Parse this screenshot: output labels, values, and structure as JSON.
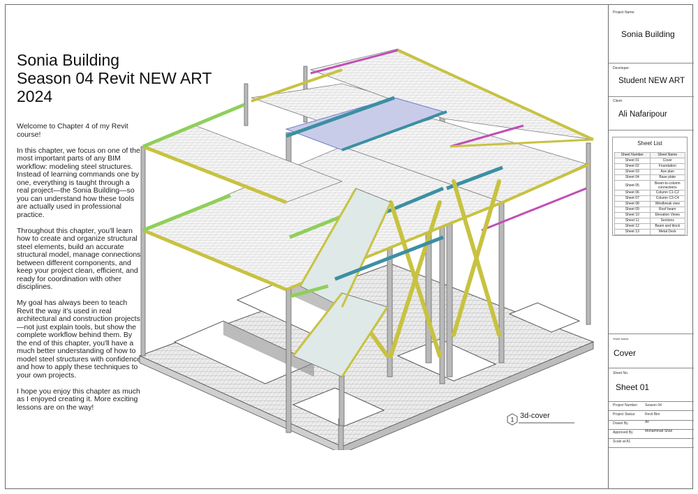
{
  "title_lines": [
    "Sonia Building",
    "Season 04 Revit NEW ART",
    "2024"
  ],
  "paragraphs": [
    "Welcome to Chapter  4 of my Revit course!",
    "In this chapter, we focus on one of the most important parts of any BIM workflow: modeling steel structures. Instead of learning commands one by one, everything is taught through a real project—the Sonia Building—so you can understand how these tools are actually used in professional practice.",
    "Throughout this chapter, you'll learn how to create and organize structural steel elements, build an accurate structural model, manage connections between different components, and keep your project clean, efficient, and ready for coordination with other disciplines.",
    "My goal has always been to teach Revit the way it's used in real architectural and construction projects—not just explain tools, but show the complete workflow behind them. By the end of this chapter, you'll have a much better understanding of how to model steel structures with confidence and how to apply these techniques to your own projects.",
    "I hope you enjoy this chapter as much as I enjoyed creating it. More exciting lessons are on the way!"
  ],
  "view_tag": {
    "number": "1",
    "label": "3d-cover"
  },
  "title_block": {
    "project_name_label": "Project Name:",
    "project_name": "Sonia Building",
    "developer_label": "Developer:",
    "developer": "Student NEW ART",
    "client_label": "Client:",
    "client": "Ali Nafaripour",
    "sheet_name_label": "Sheet Name:",
    "sheet_name": "Cover",
    "sheet_no_label": "Sheet No.",
    "sheet_no": "Sheet 01",
    "fields": [
      {
        "label": "Project Number:",
        "value": "Season 04"
      },
      {
        "label": "Project Status:",
        "value": "Revit Bim"
      },
      {
        "label": "Drawn By",
        "value": "Ali"
      },
      {
        "label": "Approved By",
        "value": "Mohammad Shali"
      },
      {
        "label": "Scale at A1",
        "value": ""
      }
    ]
  },
  "sheet_list": {
    "title": "Sheet List",
    "headers": [
      "Sheet Number",
      "Sheet Name"
    ],
    "rows": [
      [
        "Sheet 01",
        "Cover"
      ],
      [
        "Sheet 02",
        "Foundation"
      ],
      [
        "Sheet 03",
        "Axe plan"
      ],
      [
        "Sheet 04",
        "Base plate"
      ],
      [
        "Sheet 05",
        "Beam-to-column connections"
      ],
      [
        "Sheet 06",
        "Column C1-C2"
      ],
      [
        "Sheet 07",
        "Column C3-C4"
      ],
      [
        "Sheet 08",
        "Windbreak view"
      ],
      [
        "Sheet 09",
        "Roof beam"
      ],
      [
        "Sheet 10",
        "Elevation Views"
      ],
      [
        "Sheet 11",
        "Sections"
      ],
      [
        "Sheet 12",
        "Beam and block"
      ],
      [
        "Sheet 13",
        "Metal Deck"
      ]
    ]
  },
  "colors": {
    "beam_yellow": "#c8c241",
    "beam_green": "#8fcf5a",
    "beam_teal": "#3c8fa3",
    "beam_magenta": "#c04fb3",
    "beam_blue": "#6f79c8",
    "column_gray": "#a9a9a9"
  }
}
